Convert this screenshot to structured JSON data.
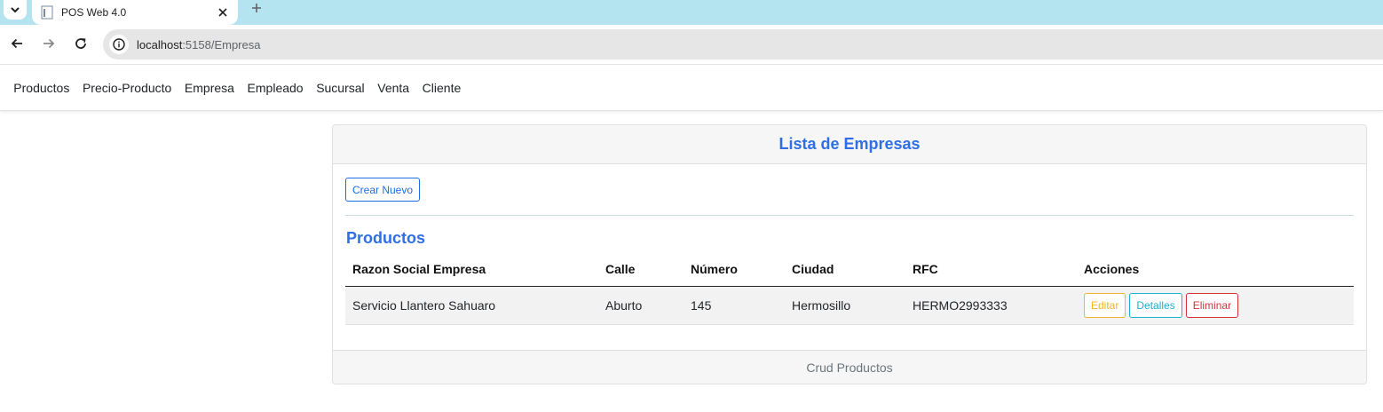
{
  "browser": {
    "tab_title": "POS Web 4.0",
    "url_host": "localhost",
    "url_path": ":5158/Empresa"
  },
  "nav": {
    "items": [
      "Productos",
      "Precio-Producto",
      "Empresa",
      "Empleado",
      "Sucursal",
      "Venta",
      "Cliente"
    ]
  },
  "card": {
    "header_title": "Lista de Empresas",
    "create_button": "Crear Nuevo",
    "section_title": "Productos",
    "footer_text": "Crud Productos"
  },
  "table": {
    "columns": [
      "Razon Social Empresa",
      "Calle",
      "Número",
      "Ciudad",
      "RFC",
      "Acciones"
    ],
    "rows": [
      [
        "Servicio Llantero Sahuaro",
        "Aburto",
        "145",
        "Hermosillo",
        "HERMO2993333"
      ]
    ],
    "actions": {
      "edit": "Editar",
      "details": "Detalles",
      "delete": "Eliminar"
    }
  },
  "colors": {
    "tabstrip": "#b3e4f0",
    "primary": "#1a6ee8",
    "warning": "#f2b52b",
    "info": "#19b2d6",
    "danger": "#d8303f"
  }
}
